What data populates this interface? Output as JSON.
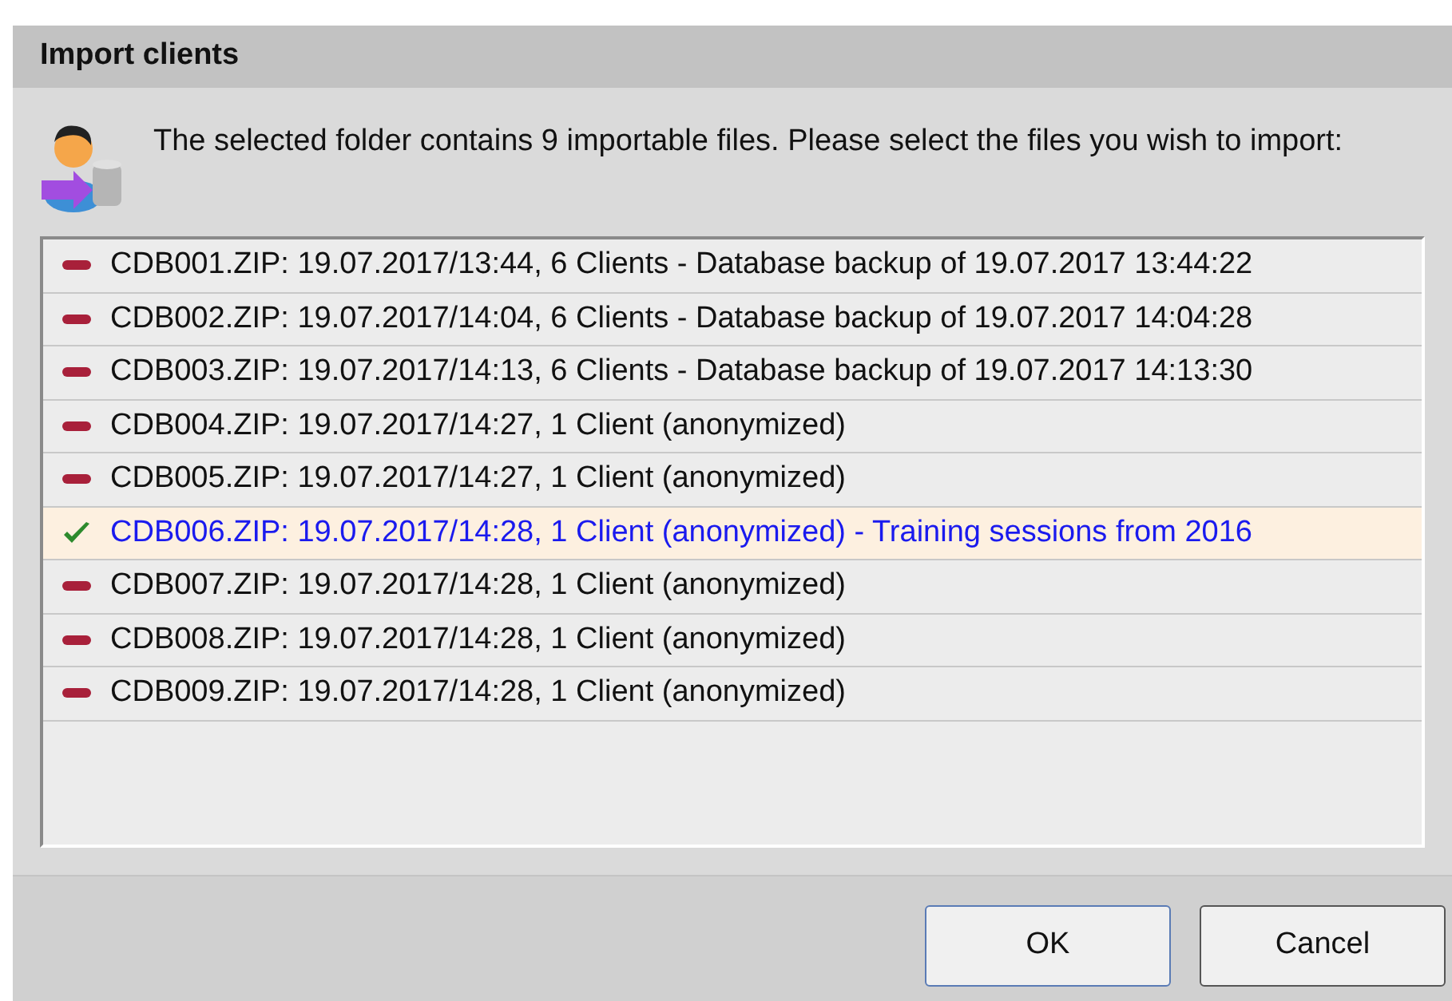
{
  "dialog": {
    "title": "Import clients"
  },
  "message": "The selected folder contains 9 importable files. Please select the files you wish to import:",
  "files": [
    {
      "label": "CDB001.ZIP: 19.07.2017/13:44, 6 Clients - Database backup of 19.07.2017 13:44:22",
      "selected": false
    },
    {
      "label": "CDB002.ZIP: 19.07.2017/14:04, 6 Clients - Database backup of 19.07.2017 14:04:28",
      "selected": false
    },
    {
      "label": "CDB003.ZIP: 19.07.2017/14:13, 6 Clients - Database backup of 19.07.2017 14:13:30",
      "selected": false
    },
    {
      "label": "CDB004.ZIP: 19.07.2017/14:27, 1 Client (anonymized)",
      "selected": false
    },
    {
      "label": "CDB005.ZIP: 19.07.2017/14:27, 1 Client (anonymized)",
      "selected": false
    },
    {
      "label": "CDB006.ZIP: 19.07.2017/14:28, 1 Client (anonymized) - Training sessions from 2016",
      "selected": true
    },
    {
      "label": "CDB007.ZIP: 19.07.2017/14:28, 1 Client (anonymized)",
      "selected": false
    },
    {
      "label": "CDB008.ZIP: 19.07.2017/14:28, 1 Client (anonymized)",
      "selected": false
    },
    {
      "label": "CDB009.ZIP: 19.07.2017/14:28, 1 Client (anonymized)",
      "selected": false
    }
  ],
  "buttons": [
    "OK",
    "Cancel"
  ]
}
